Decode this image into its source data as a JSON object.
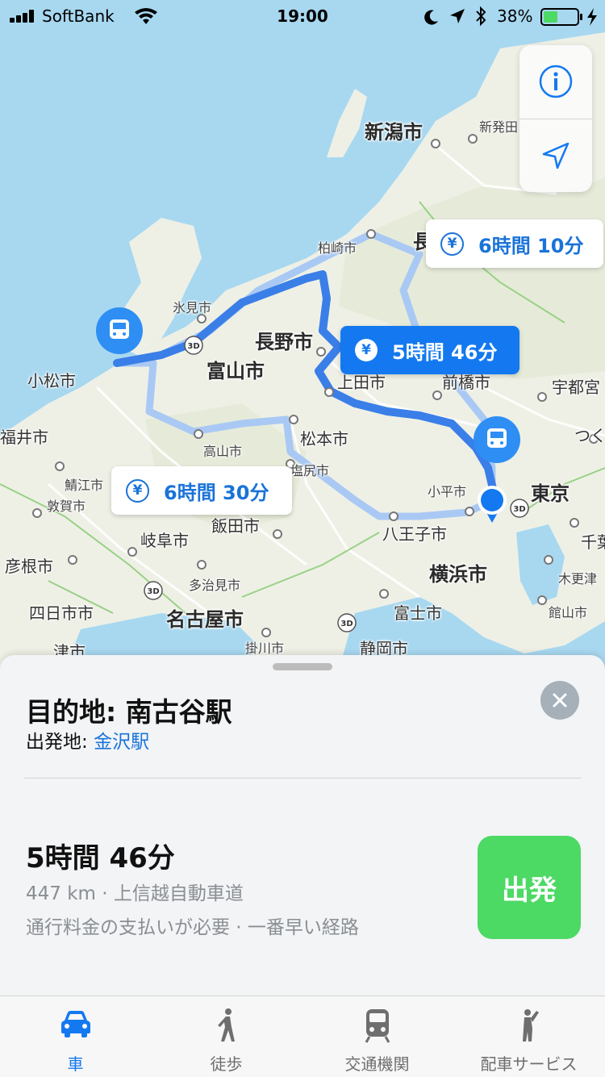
{
  "status_bar": {
    "carrier": "SoftBank",
    "time": "19:00",
    "battery": "38%"
  },
  "map": {
    "labels": [
      {
        "text": "新潟市",
        "size": "big"
      },
      {
        "text": "新発田",
        "size": "sm"
      },
      {
        "text": "柏崎市",
        "size": "sm"
      },
      {
        "text": "長",
        "size": "big"
      },
      {
        "text": "氷見市",
        "size": "sm"
      },
      {
        "text": "長野市",
        "size": "big"
      },
      {
        "text": "富山市",
        "size": "big"
      },
      {
        "text": "小松市",
        "size": "med"
      },
      {
        "text": "上田市",
        "size": "med"
      },
      {
        "text": "前橋市",
        "size": "med"
      },
      {
        "text": "宇都宮",
        "size": "med"
      },
      {
        "text": "福井市",
        "size": "med"
      },
      {
        "text": "松本市",
        "size": "med"
      },
      {
        "text": "高山市",
        "size": "sm"
      },
      {
        "text": "つく",
        "size": "med"
      },
      {
        "text": "鯖江市",
        "size": "sm"
      },
      {
        "text": "塩尻市",
        "size": "sm"
      },
      {
        "text": "敦賀市",
        "size": "sm"
      },
      {
        "text": "小平市",
        "size": "sm"
      },
      {
        "text": "東京",
        "size": "big"
      },
      {
        "text": "飯田市",
        "size": "med"
      },
      {
        "text": "岐阜市",
        "size": "med"
      },
      {
        "text": "八王子市",
        "size": "med"
      },
      {
        "text": "千葉",
        "size": "med"
      },
      {
        "text": "彦根市",
        "size": "med"
      },
      {
        "text": "横浜市",
        "size": "big"
      },
      {
        "text": "多治見市",
        "size": "sm"
      },
      {
        "text": "木更津",
        "size": "sm"
      },
      {
        "text": "四日市市",
        "size": "med"
      },
      {
        "text": "名古屋市",
        "size": "big"
      },
      {
        "text": "富士市",
        "size": "med"
      },
      {
        "text": "館山市",
        "size": "sm"
      },
      {
        "text": "掛川市",
        "size": "sm"
      },
      {
        "text": "静岡市",
        "size": "med"
      },
      {
        "text": "津市",
        "size": "med"
      }
    ],
    "road_shield": "3D"
  },
  "callouts": {
    "route_top": "6時間 10分",
    "route_main": "5時間 46分",
    "route_left": "6時間 30分",
    "yen": "¥"
  },
  "card": {
    "destination": "目的地: 南古谷駅",
    "origin_prefix": "出発地: ",
    "origin_name": "金沢駅",
    "route_time": "5時間 46分",
    "route_distance": "447 km · 上信越自動車道",
    "route_note": "通行料金の支払いが必要 · 一番早い経路",
    "go_label": "出発"
  },
  "tabs": [
    {
      "label": "車",
      "icon": "car-icon",
      "active": true
    },
    {
      "label": "徒歩",
      "icon": "walking-icon",
      "active": false
    },
    {
      "label": "交通機関",
      "icon": "train-icon",
      "active": false
    },
    {
      "label": "配車サービス",
      "icon": "ride-hail-icon",
      "active": false
    }
  ],
  "colors": {
    "accent": "#1479f0",
    "route": "#3a7ee8",
    "go_button": "#4cd964",
    "sea": "#a8d8f0"
  }
}
